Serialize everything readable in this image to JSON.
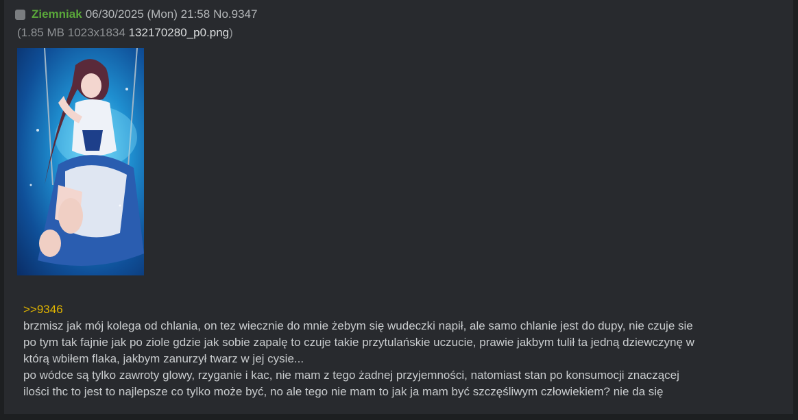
{
  "post": {
    "name": "Ziemniak",
    "datetime": "06/30/2025 (Mon) 21:58",
    "number": "No.9347",
    "file": {
      "open_paren": "(",
      "meta": "1.85 MB 1023x1834",
      "filename": "132170280_p0.png",
      "close_paren": ")"
    },
    "quote_link": ">>9346",
    "body_lines": [
      "brzmisz jak mój kolega od chlania, on tez wiecznie do mnie żebym się wudeczki napił, ale samo chlanie jest do dupy, nie czuje sie",
      "po tym tak fajnie jak po ziole gdzie jak sobie zapalę to czuje takie przytulańskie uczucie, prawie jakbym tulił ta jedną dziewczynę w",
      "którą wbiłem flaka, jakbym zanurzył twarz w jej cysie...",
      "po wódce są tylko zawroty glowy, rzyganie i kac, nie mam z tego żadnej przyjemności, natomiast stan po konsumocji znaczącej",
      "ilości thc to jest to najlepsze co tylko może być, no ale tego nie mam to jak ja mam być szczęśliwym człowiekiem? nie da się"
    ]
  },
  "colors": {
    "page_bg": "#1d1f21",
    "post_bg": "#282a2e",
    "name": "#5aa83a",
    "quote": "#e0b400",
    "text": "#c5c8c6"
  },
  "icons": {
    "checkbox": "checkbox-icon"
  }
}
